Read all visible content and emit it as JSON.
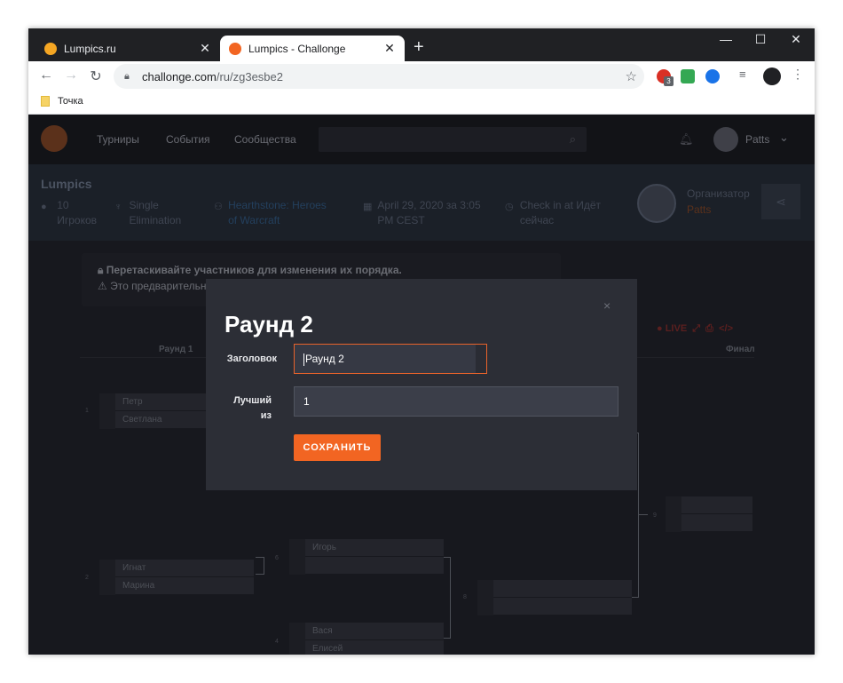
{
  "browser": {
    "tabs": [
      {
        "title": "Lumpics.ru",
        "active": false,
        "favicon_color": "#f5a623"
      },
      {
        "title": "Lumpics - Challonge",
        "active": true,
        "favicon_color": "#f26522"
      }
    ],
    "new_tab_label": "+",
    "window_controls": {
      "minimize": "—",
      "maximize": "☐",
      "close": "✕"
    },
    "url_host": "challonge.com",
    "url_path": "/ru/zg3esbe2",
    "extension_badge": "3",
    "bookmarks": [
      {
        "label": "Точка"
      }
    ]
  },
  "site": {
    "nav": [
      "Турниры",
      "События",
      "Сообщества"
    ],
    "user": "Patts",
    "tournament": {
      "name": "Lumpics",
      "participants": "10 Игроков",
      "format": "Single Elimination",
      "game": "Hearthstone: Heroes of Warcraft",
      "date": "April 29, 2020 за 3:05 PM CEST",
      "checkin": "Check in at Идёт сейчас",
      "organizer_label": "Организатор",
      "organizer_name": "Patts"
    },
    "notice": {
      "line1": "Перетаскивайте участников для изменения их порядка.",
      "line2": "Это предварительна"
    },
    "bracket_tools_label": "LIVE",
    "rounds": [
      "Раунд 1",
      "Финал"
    ],
    "matches": [
      {
        "id": "1",
        "p1_seed": "",
        "p1": "Петр",
        "p2_seed": "",
        "p2": "Светлана"
      },
      {
        "id": "2",
        "p1_seed": "",
        "p1": "Игнат",
        "p2_seed": "",
        "p2": "Марина"
      },
      {
        "id": "6",
        "p1_seed": "",
        "p1": "Игорь",
        "p2_seed": "",
        "p2": ""
      },
      {
        "id": "4",
        "p1_seed": "",
        "p1": "Вася",
        "p2_seed": "",
        "p2": "Елисей"
      },
      {
        "id": "8",
        "p1_seed": "",
        "p1": "",
        "p2_seed": "",
        "p2": ""
      },
      {
        "id": "9",
        "p1_seed": "",
        "p1": "",
        "p2_seed": "",
        "p2": ""
      }
    ]
  },
  "modal": {
    "title": "Раунд 2",
    "close": "×",
    "fields": [
      {
        "label": "Заголовок",
        "value": "Раунд 2"
      },
      {
        "label": "Лучший из",
        "value": "1"
      }
    ],
    "save_label": "СОХРАНИТЬ"
  },
  "colors": {
    "accent": "#f26522",
    "modal_bg": "#2c2e36",
    "page_bg": "#1c1d24"
  }
}
